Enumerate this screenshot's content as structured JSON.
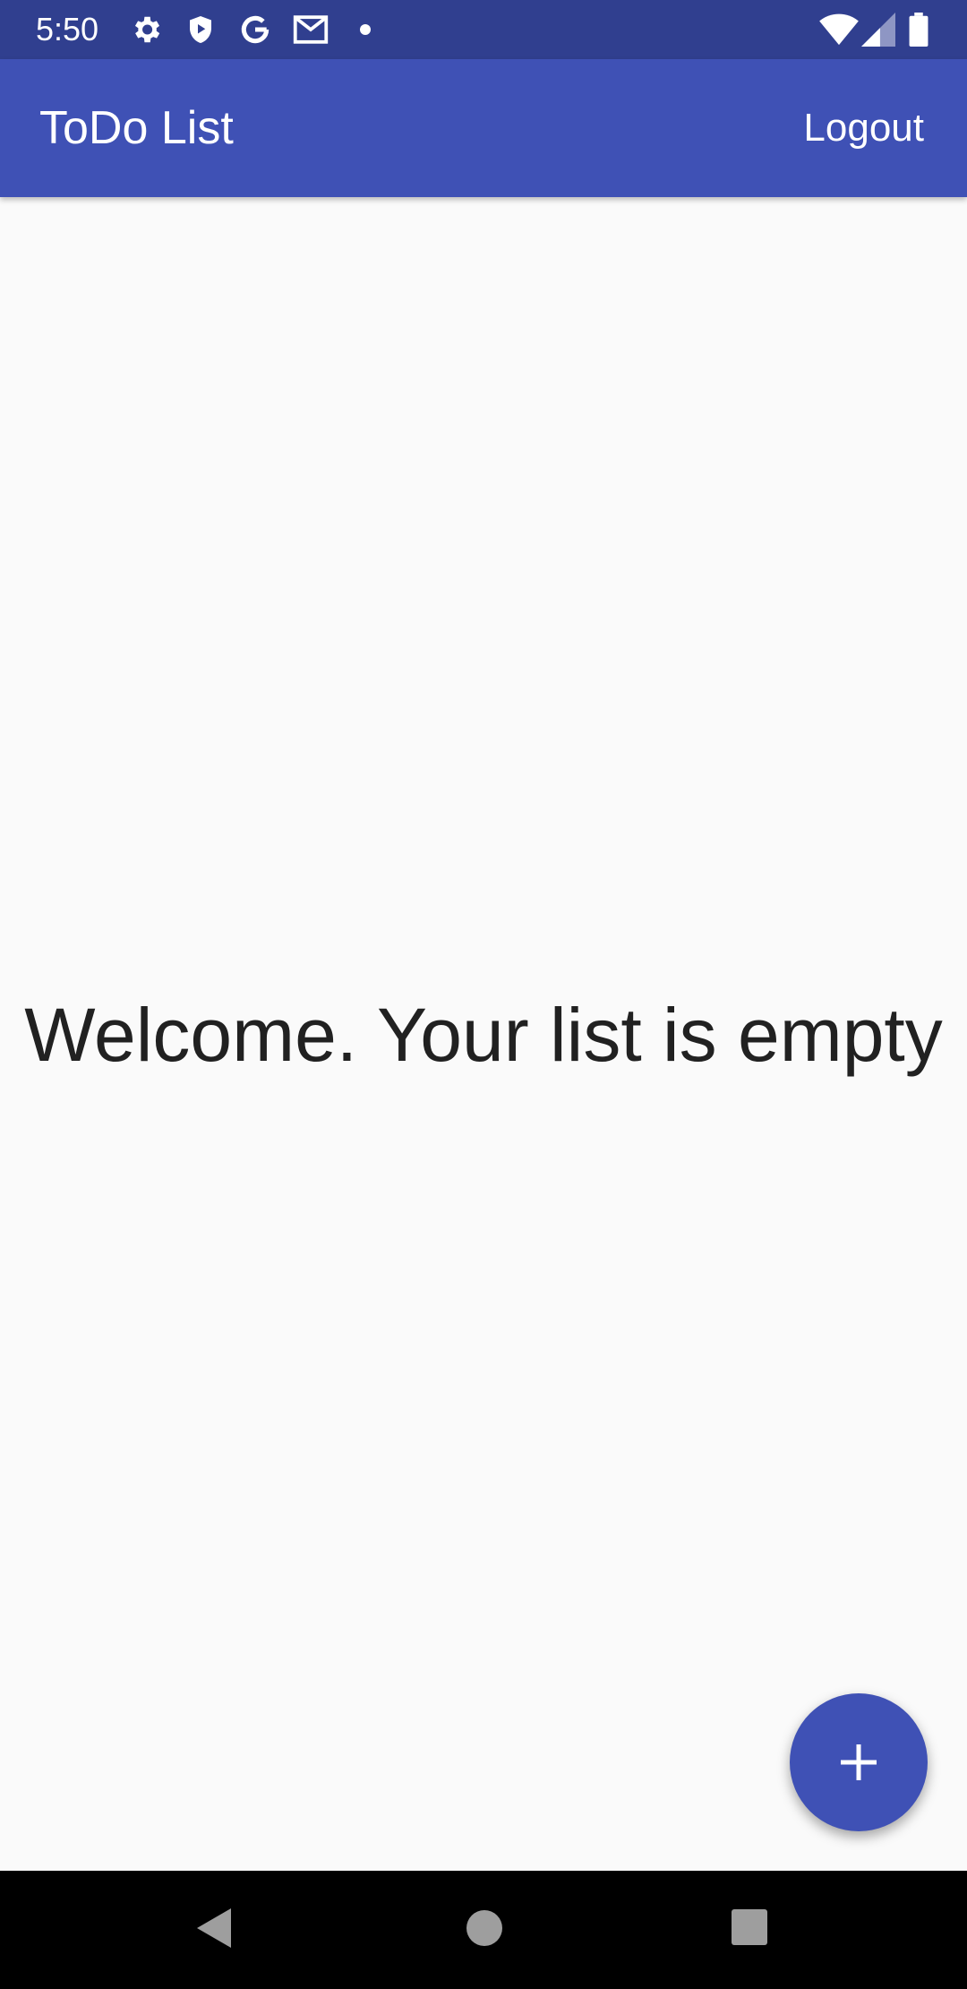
{
  "status_bar": {
    "time": "5:50",
    "icons": [
      "gear-icon",
      "shield-play-icon",
      "google-g-icon",
      "gmail-icon",
      "notification-dot-icon",
      "wifi-icon",
      "signal-icon",
      "battery-icon"
    ]
  },
  "app_bar": {
    "title": "ToDo List",
    "logout_label": "Logout"
  },
  "main": {
    "empty_message": "Welcome. Your list is empty"
  },
  "fab": {
    "icon": "plus-icon"
  },
  "nav_bar": {
    "icons": [
      "back-icon",
      "home-icon",
      "recents-icon"
    ]
  },
  "colors": {
    "primary": "#3f51b5",
    "primary_dark": "#303f8f",
    "background": "#fafafa",
    "text": "#212121"
  }
}
